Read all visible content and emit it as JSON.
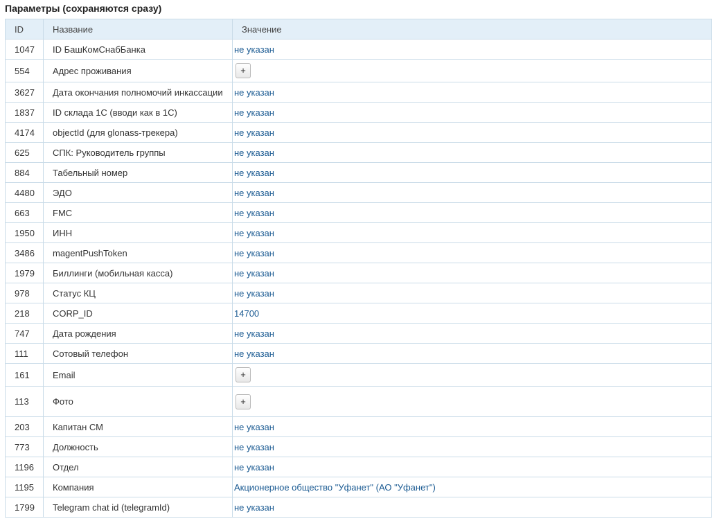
{
  "title": "Параметры (сохраняются сразу)",
  "columns": {
    "id": "ID",
    "name": "Название",
    "value": "Значение"
  },
  "add_label": "+",
  "rows": [
    {
      "id": "1047",
      "name": "ID БашКомСнабБанка",
      "value": "не указан",
      "type": "link"
    },
    {
      "id": "554",
      "name": "Адрес проживания",
      "value": "",
      "type": "button"
    },
    {
      "id": "3627",
      "name": "Дата окончания полномочий инкассации",
      "value": "не указан",
      "type": "link"
    },
    {
      "id": "1837",
      "name": "ID склада 1С (вводи как в 1С)",
      "value": "не указан",
      "type": "link"
    },
    {
      "id": "4174",
      "name": "objectId (для glonass-трекера)",
      "value": "не указан",
      "type": "link"
    },
    {
      "id": "625",
      "name": "СПК: Руководитель группы",
      "value": "не указан",
      "type": "link"
    },
    {
      "id": "884",
      "name": "Табельный номер",
      "value": "не указан",
      "type": "link"
    },
    {
      "id": "4480",
      "name": "ЭДО",
      "value": "не указан",
      "type": "link"
    },
    {
      "id": "663",
      "name": "FMC",
      "value": "не указан",
      "type": "link"
    },
    {
      "id": "1950",
      "name": "ИНН",
      "value": "не указан",
      "type": "link"
    },
    {
      "id": "3486",
      "name": "magentPushToken",
      "value": "не указан",
      "type": "link"
    },
    {
      "id": "1979",
      "name": "Биллинги (мобильная касса)",
      "value": "не указан",
      "type": "link"
    },
    {
      "id": "978",
      "name": "Статус КЦ",
      "value": "не указан",
      "type": "link"
    },
    {
      "id": "218",
      "name": "CORP_ID",
      "value": "14700",
      "type": "link"
    },
    {
      "id": "747",
      "name": "Дата рождения",
      "value": "не указан",
      "type": "link"
    },
    {
      "id": "111",
      "name": "Сотовый телефон",
      "value": "не указан",
      "type": "link"
    },
    {
      "id": "161",
      "name": "Email",
      "value": "",
      "type": "button"
    },
    {
      "id": "113",
      "name": "Фото",
      "value": "",
      "type": "button-tall"
    },
    {
      "id": "203",
      "name": "Капитан СМ",
      "value": "не указан",
      "type": "link"
    },
    {
      "id": "773",
      "name": "Должность",
      "value": "не указан",
      "type": "link"
    },
    {
      "id": "1196",
      "name": "Отдел",
      "value": "не указан",
      "type": "link"
    },
    {
      "id": "1195",
      "name": "Компания",
      "value": "Акционерное общество \"Уфанет\" (АО \"Уфанет\")",
      "type": "link"
    },
    {
      "id": "1799",
      "name": "Telegram chat id (telegramId)",
      "value": "не указан",
      "type": "link"
    }
  ]
}
